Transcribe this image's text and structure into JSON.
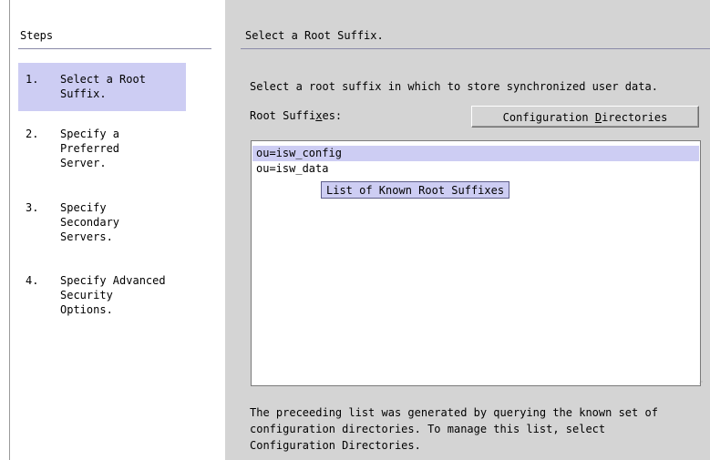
{
  "steps": {
    "title": "Steps",
    "items": [
      {
        "num": "1.",
        "label": "Select a Root\nSuffix."
      },
      {
        "num": "2.",
        "label": "Specify a\nPreferred\nServer."
      },
      {
        "num": "3.",
        "label": "Specify\nSecondary\nServers."
      },
      {
        "num": "4.",
        "label": "Specify Advanced\nSecurity\nOptions."
      }
    ],
    "selected_index": 0
  },
  "main": {
    "title": "Select a Root Suffix.",
    "instruction": "Select a root suffix in which to store synchronized user data.",
    "list_label": {
      "before": "Root Suffi",
      "mnemonic": "x",
      "after": "es:"
    },
    "config_button": {
      "before": "Configuration ",
      "mnemonic": "D",
      "after": "irectories"
    },
    "root_suffixes": [
      "ou=isw_config",
      "ou=isw_data"
    ],
    "selected_suffix_index": 0,
    "tooltip": "List of Known Root Suffixes",
    "footer": "The preceeding list was generated by querying the known set of\nconfiguration directories. To manage this list, select\nConfiguration Directories."
  },
  "colors": {
    "selection": "#cdcdf3",
    "panel": "#d4d4d4",
    "rule": "#8a8aa8"
  }
}
